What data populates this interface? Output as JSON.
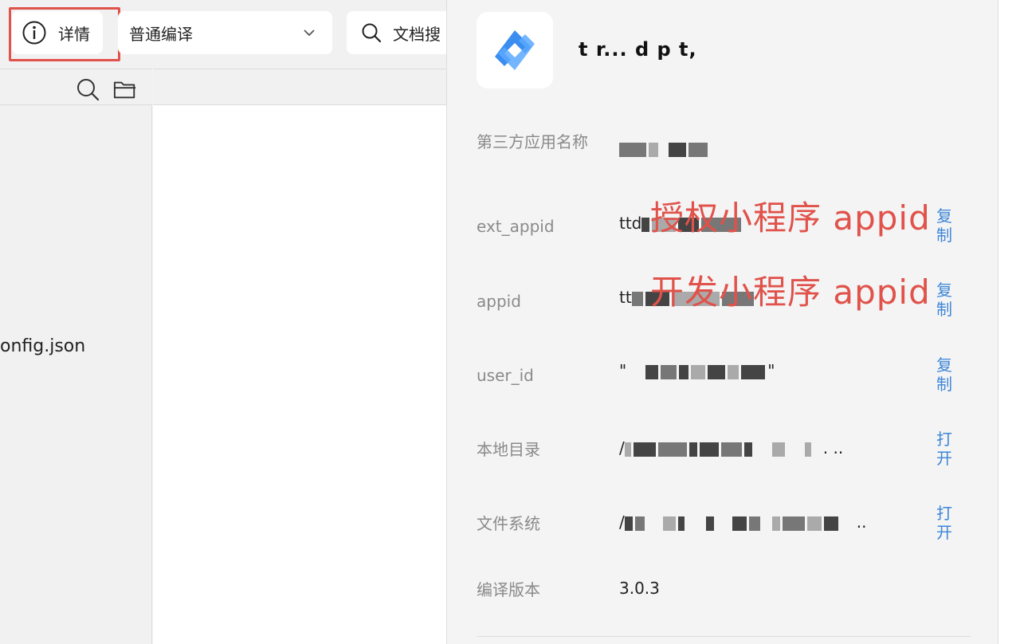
{
  "toolbar": {
    "details_label": "详情",
    "compile_mode": "普通编译",
    "doc_search_label": "文档搜"
  },
  "icons": {
    "info": "info-icon",
    "chevron": "chevron-down-icon",
    "search": "search-icon",
    "folder": "folder-icon",
    "app_logo": "app-logo-icon"
  },
  "file_tree": {
    "item": "onfig.json"
  },
  "details": {
    "app_name": "t r... d p   t,",
    "rows": {
      "third_party_name": {
        "label": "第三方应用名称",
        "value": ""
      },
      "ext_appid": {
        "label": "ext_appid",
        "value_prefix": "ttd",
        "action": "复制"
      },
      "appid": {
        "label": "appid",
        "value_prefix": "tt",
        "action": "复制"
      },
      "user_id": {
        "label": "user_id",
        "value_prefix": "\"",
        "value_suffix": "\"",
        "action": "复制"
      },
      "local_dir": {
        "label": "本地目录",
        "value_prefix": "/",
        "value_suffix": ". ..",
        "action": "打开"
      },
      "file_system": {
        "label": "文件系统",
        "value_prefix": "/",
        "value_suffix": "..",
        "action": "打开"
      },
      "compile_version": {
        "label": "编译版本",
        "value": "3.0.3"
      }
    },
    "annotations": {
      "ext_appid_note": "授权小程序 appid",
      "appid_note": "开发小程序 appid"
    }
  },
  "colors": {
    "highlight": "#e0524a",
    "link": "#3e86d6",
    "label": "#8a8a8a"
  }
}
